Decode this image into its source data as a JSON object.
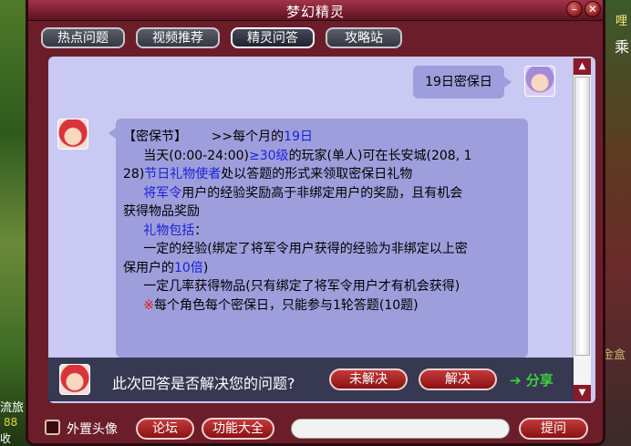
{
  "background": {
    "right_top": "哩",
    "right_mid": "乘",
    "right_low": "金盒",
    "left_line1": "流旅",
    "left_line2": "88",
    "left_line3": "收"
  },
  "window": {
    "title": "梦幻精灵"
  },
  "tabs": [
    {
      "label": "热点问题"
    },
    {
      "label": "视频推荐"
    },
    {
      "label": "精灵问答"
    },
    {
      "label": "攻略站"
    }
  ],
  "chat": {
    "user_message": "19日密保日",
    "bot": {
      "l1_a": "【密保节】      >>每个月的",
      "l1_b": "19日",
      "l2_a": "     当天(0:00-24:00)",
      "l2_b": "≥30级",
      "l2_c": "的玩家(单人)可在长安城(208, 1",
      "l3_a": "28)",
      "l3_b": "节日礼物使者",
      "l3_c": "处以答题的形式来领取密保日礼物",
      "l4_a": "     ",
      "l4_b": "将军令",
      "l4_c": "用户的经验奖励高于非绑定用户的奖励，且有机会",
      "l5": "获得物品奖励",
      "l6_a": "     ",
      "l6_b": "礼物包括",
      "l6_c": "：",
      "l7": "     一定的经验(绑定了将军令用户获得的经验为非绑定以上密",
      "l8_a": "保用户的",
      "l8_b": "10倍",
      "l8_c": ")",
      "l9": "     一定几率获得物品(只有绑定了将军令用户才有机会获得)",
      "l10_a": "     ",
      "l10_b": "※",
      "l10_c": "每个角色每个密保日，只能参与1轮答题(10题)"
    }
  },
  "feedback": {
    "question": "此次回答是否解决您的问题?",
    "unsolved": "未解决",
    "solved": "解决",
    "share": "➔ 分享"
  },
  "bottom": {
    "external_avatar": "外置头像",
    "forum": "论坛",
    "features": "功能大全",
    "ask": "提问",
    "input_placeholder": ""
  },
  "colors": {
    "frame": "#6b1e2a",
    "chat_bg": "#c9c9f3",
    "bubble": "#9e9edc",
    "highlight_blue": "#1a22d8",
    "highlight_red": "#e01818",
    "share_green": "#3ccf3c"
  }
}
